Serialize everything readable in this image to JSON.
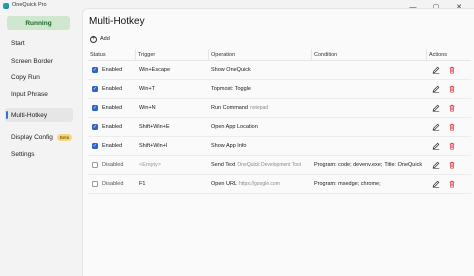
{
  "window": {
    "title": "OneQuick Pro",
    "controls": {
      "minimize": "—",
      "maximize": "▢",
      "close": "✕"
    }
  },
  "sidebar": {
    "running_label": "Running",
    "items": [
      {
        "label": "Start"
      },
      {
        "label": "Screen Border"
      },
      {
        "label": "Copy Run"
      },
      {
        "label": "Input Phrase"
      },
      {
        "label": "Multi-Hotkey",
        "active": true
      },
      {
        "label": "Display Config",
        "badge": "Beta"
      },
      {
        "label": "Settings"
      }
    ]
  },
  "main": {
    "title": "Multi-Hotkey",
    "add_label": "Add",
    "columns": {
      "status": "Status",
      "trigger": "Trigger",
      "operation": "Operation",
      "condition": "Condition",
      "actions": "Actions"
    },
    "rows": [
      {
        "checked": true,
        "status": "Enabled",
        "trigger": "Win+Escape",
        "op": "Show OneQuick",
        "op_arg": "",
        "condition": "",
        "cond_rest": ""
      },
      {
        "checked": true,
        "status": "Enabled",
        "trigger": "Win+T",
        "op": "Topmost: Toggle",
        "op_arg": "",
        "condition": "",
        "cond_rest": ""
      },
      {
        "checked": true,
        "status": "Enabled",
        "trigger": "Win+N",
        "op": "Run Command",
        "op_arg": "notepad",
        "condition": "",
        "cond_rest": ""
      },
      {
        "checked": true,
        "status": "Enabled",
        "trigger": "Shift+Win+E",
        "op": "Open App Location",
        "op_arg": "",
        "condition": "",
        "cond_rest": ""
      },
      {
        "checked": true,
        "status": "Enabled",
        "trigger": "Shift+Win+I",
        "op": "Show App Info",
        "op_arg": "",
        "condition": "",
        "cond_rest": ""
      },
      {
        "checked": false,
        "status": "Disabled",
        "trigger": "<Empty>",
        "trigger_empty": true,
        "op": "Send Text",
        "op_arg": "OneQuick Development Tool",
        "condition": "Program: code; devenv.exe;",
        "cond_rest": "Title: OneQuick"
      },
      {
        "checked": false,
        "status": "Disabled",
        "trigger": "F1",
        "op": "Open URL",
        "op_arg": "https://google.com",
        "condition": "Program: msedge; chrome;",
        "cond_rest": ""
      }
    ]
  },
  "colors": {
    "accent": "#2f63c9",
    "running_bg": "#cfe6cf",
    "running_fg": "#1b6b2a",
    "delete": "#d9363e"
  }
}
